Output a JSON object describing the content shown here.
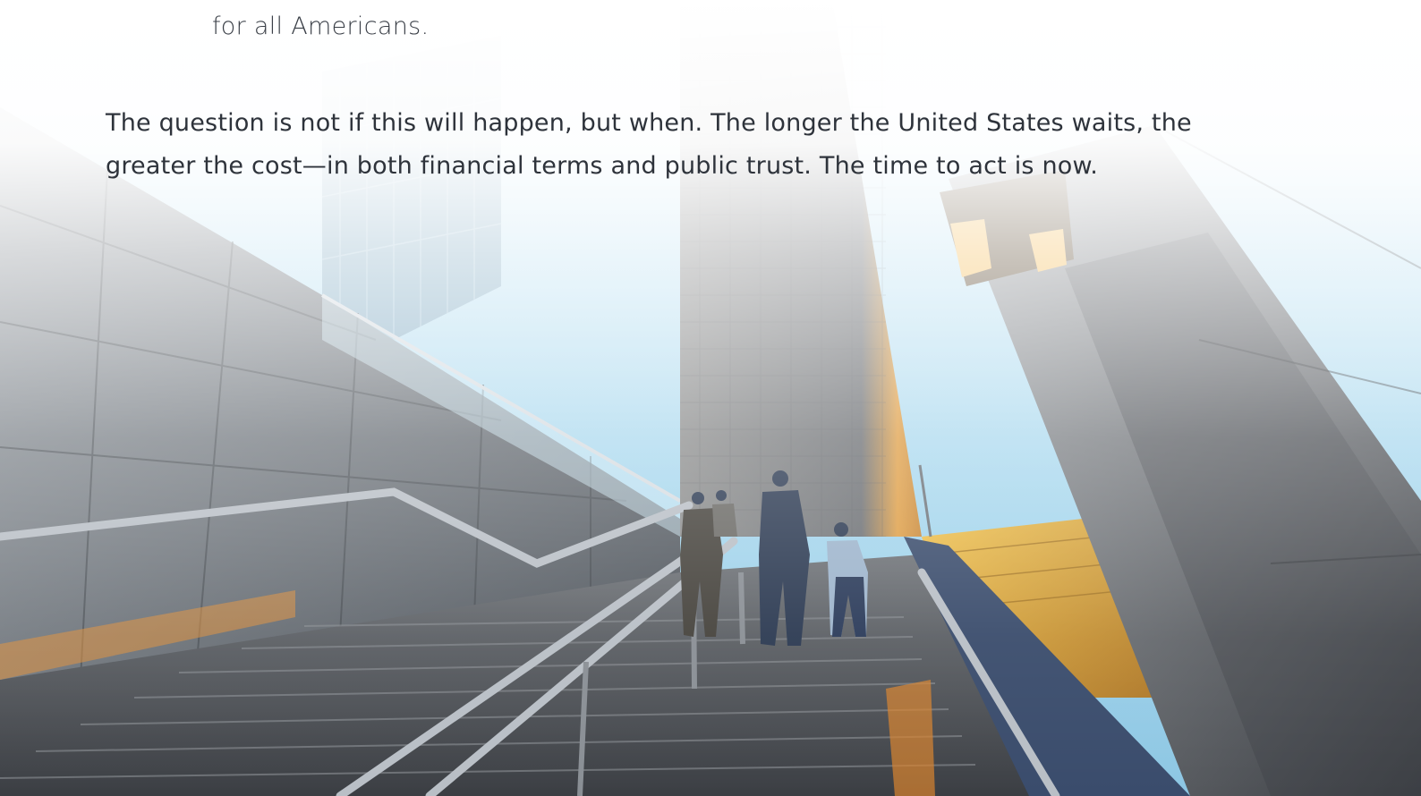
{
  "document": {
    "prev_paragraph_tail": "for all Americans.",
    "closing_paragraph_line1": "The question is not if this will happen, but when. The longer the United States waits, the",
    "closing_paragraph_line2": "greater the cost—in both financial terms and public trust. The time to act is now."
  },
  "image": {
    "subject": "people-climbing-stairs-between-buildings-photo",
    "colors": {
      "sky": "#bfe2f2",
      "granite": "#6c7178",
      "sunlight": "#e8a43b",
      "fade": "#ffffff"
    }
  }
}
